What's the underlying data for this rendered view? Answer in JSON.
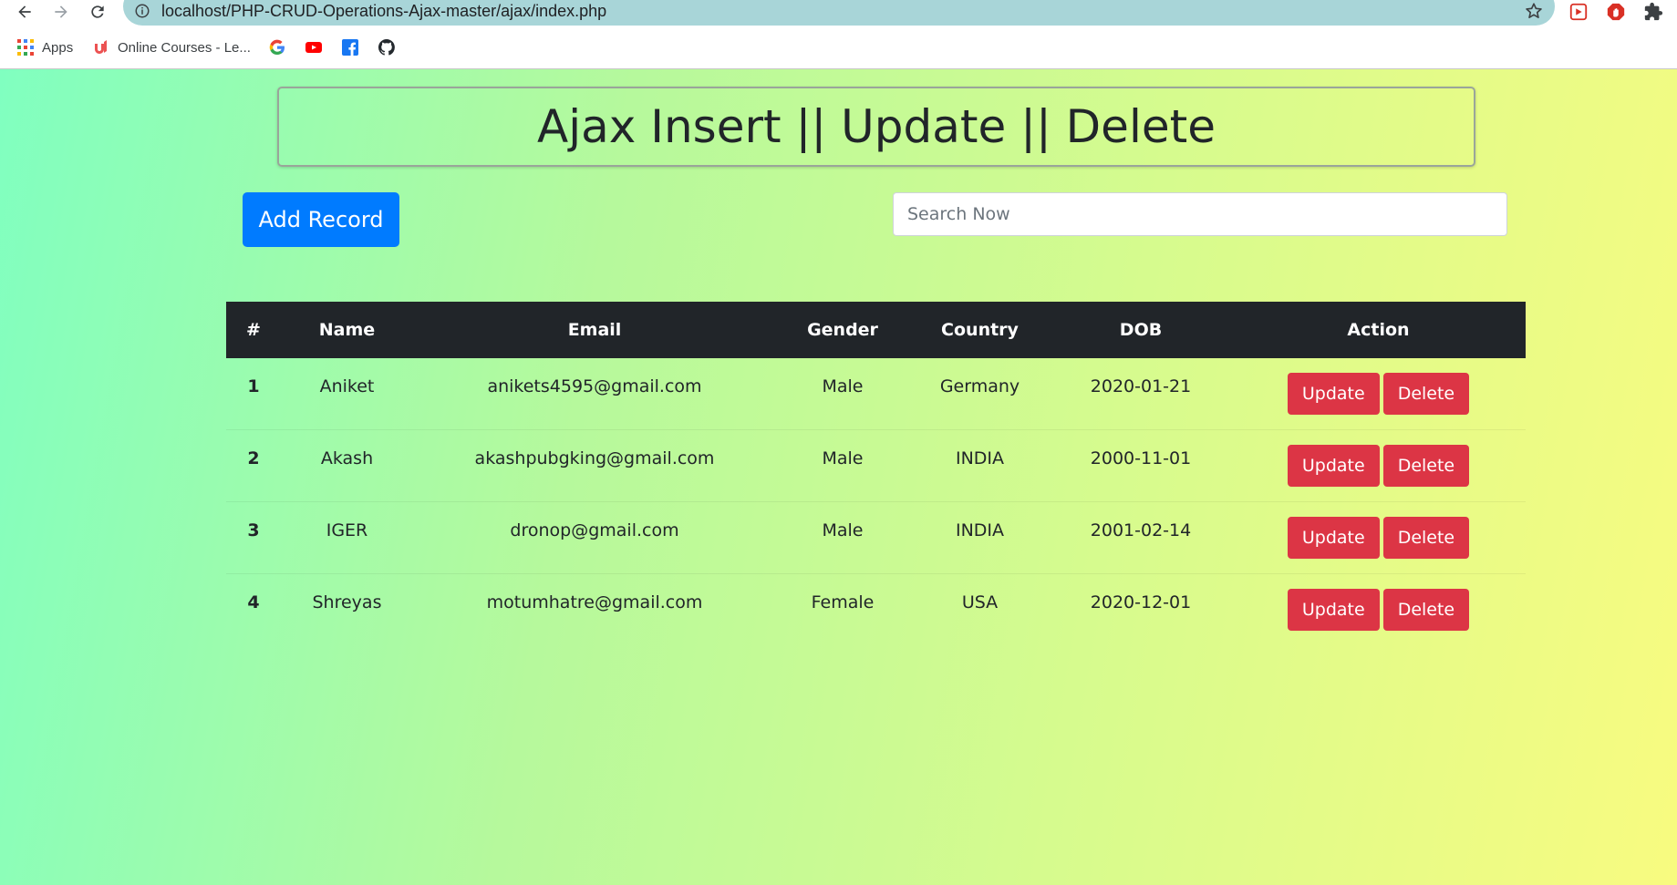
{
  "browser": {
    "url": "localhost/PHP-CRUD-Operations-Ajax-master/ajax/index.php",
    "icons": {
      "back": "back-arrow-icon",
      "forward": "forward-arrow-icon",
      "reload": "reload-icon",
      "info": "info-icon",
      "star": "star-icon"
    },
    "bookmarks": [
      {
        "label": "Apps",
        "icon": "apps-grid-icon"
      },
      {
        "label": "Online Courses - Le...",
        "icon": "udemy-icon"
      },
      {
        "label": "",
        "icon": "google-icon"
      },
      {
        "label": "",
        "icon": "youtube-icon"
      },
      {
        "label": "",
        "icon": "facebook-icon"
      },
      {
        "label": "",
        "icon": "github-icon"
      }
    ]
  },
  "page": {
    "title": "Ajax Insert || Update || Delete",
    "add_button": "Add Record",
    "search_placeholder": "Search Now",
    "search_value": "",
    "colors": {
      "primary": "#007bff",
      "danger": "#dc3545",
      "dark": "#212529"
    }
  },
  "table": {
    "headers": [
      "#",
      "Name",
      "Email",
      "Gender",
      "Country",
      "DOB",
      "Action"
    ],
    "rows": [
      {
        "id": "1",
        "name": "Aniket",
        "email": "anikets4595@gmail.com",
        "gender": "Male",
        "country": "Germany",
        "dob": "2020-01-21",
        "update_label": "Update",
        "delete_label": "Delete"
      },
      {
        "id": "2",
        "name": "Akash",
        "email": "akashpubgking@gmail.com",
        "gender": "Male",
        "country": "INDIA",
        "dob": "2000-11-01",
        "update_label": "Update",
        "delete_label": "Delete"
      },
      {
        "id": "3",
        "name": "IGER",
        "email": "dronop@gmail.com",
        "gender": "Male",
        "country": "INDIA",
        "dob": "2001-02-14",
        "update_label": "Update",
        "delete_label": "Delete"
      },
      {
        "id": "4",
        "name": "Shreyas",
        "email": "motumhatre@gmail.com",
        "gender": "Female",
        "country": "USA",
        "dob": "2020-12-01",
        "update_label": "Update",
        "delete_label": "Delete"
      }
    ]
  }
}
